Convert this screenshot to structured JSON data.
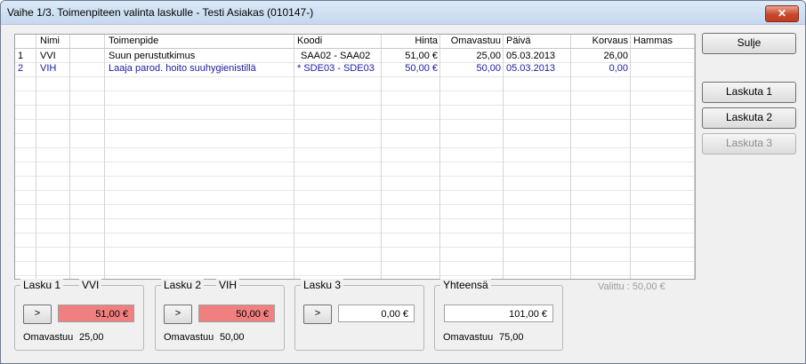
{
  "window": {
    "title": "Vaihe 1/3. Toimenpiteen valinta laskulle - Testi Asiakas (010147-)",
    "close_glyph": "✕"
  },
  "table": {
    "columns": [
      "",
      "Nimi",
      "",
      "Toimenpide",
      "Koodi",
      "Hinta",
      "Omavastuu",
      "Päivä",
      "Korvaus",
      "Hammas"
    ],
    "rows": [
      {
        "num": "1",
        "nimi": "VVI",
        "extra": "",
        "toimenpide": "Suun perustutkimus",
        "koodi": "SAA02 - SAA02",
        "hinta": "51,00 €",
        "omavastuu": "25,00",
        "paiva": "05.03.2013",
        "korvaus": "26,00",
        "hammas": "",
        "color": "#000000"
      },
      {
        "num": "2",
        "nimi": "VIH",
        "extra": "",
        "toimenpide": "Laaja parod. hoito suuhygienistillä",
        "koodi": "* SDE03 - SDE03",
        "hinta": "50,00 €",
        "omavastuu": "50,00",
        "paiva": "05.03.2013",
        "korvaus": "0,00",
        "hammas": "",
        "color": "#1a1aa6"
      }
    ]
  },
  "buttons": {
    "sulje": "Sulje",
    "laskuta1": "Laskuta 1",
    "laskuta2": "Laskuta 2",
    "laskuta3": "Laskuta 3"
  },
  "lasku1": {
    "title": "Lasku 1",
    "code": "VVI",
    "arrow": ">",
    "value": "51,00 €",
    "omavastuu_label": "Omavastuu",
    "omavastuu": "25,00"
  },
  "lasku2": {
    "title": "Lasku 2",
    "code": "VIH",
    "arrow": ">",
    "value": "50,00 €",
    "omavastuu_label": "Omavastuu",
    "omavastuu": "50,00"
  },
  "lasku3": {
    "title": "Lasku 3",
    "arrow": ">",
    "value": "0,00 €"
  },
  "yhteensa": {
    "title": "Yhteensä",
    "value": "101,00 €",
    "omavastuu_label": "Omavastuu",
    "omavastuu": "75,00"
  },
  "valittu": "Valittu :  50,00 €",
  "colors": {
    "selected_value_bg": "#f08080",
    "row2_text": "#1a1aa6",
    "titlebar": "#c5d8ee",
    "close_button": "#c7472b"
  }
}
